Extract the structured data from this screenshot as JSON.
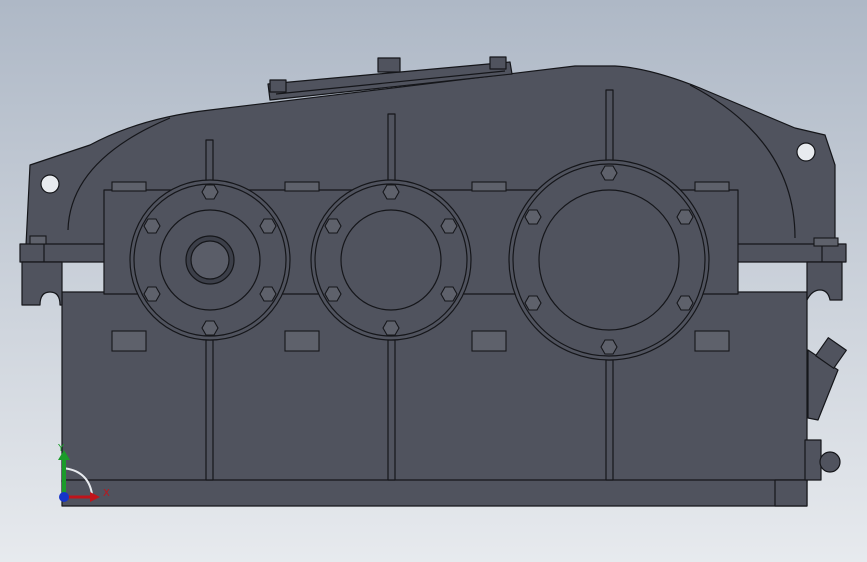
{
  "colors": {
    "bg_top": "#aeb8c6",
    "bg_bottom": "#e7eaee",
    "body": "#50535e",
    "body_dark": "#3c3f49",
    "edge": "#15161a",
    "bolt": "#5e616b",
    "axis_x": "#c0141b",
    "axis_y": "#1b9b2a",
    "axis_z": "#1634c8"
  },
  "triad": {
    "x_label": "X",
    "y_label": "Y"
  }
}
